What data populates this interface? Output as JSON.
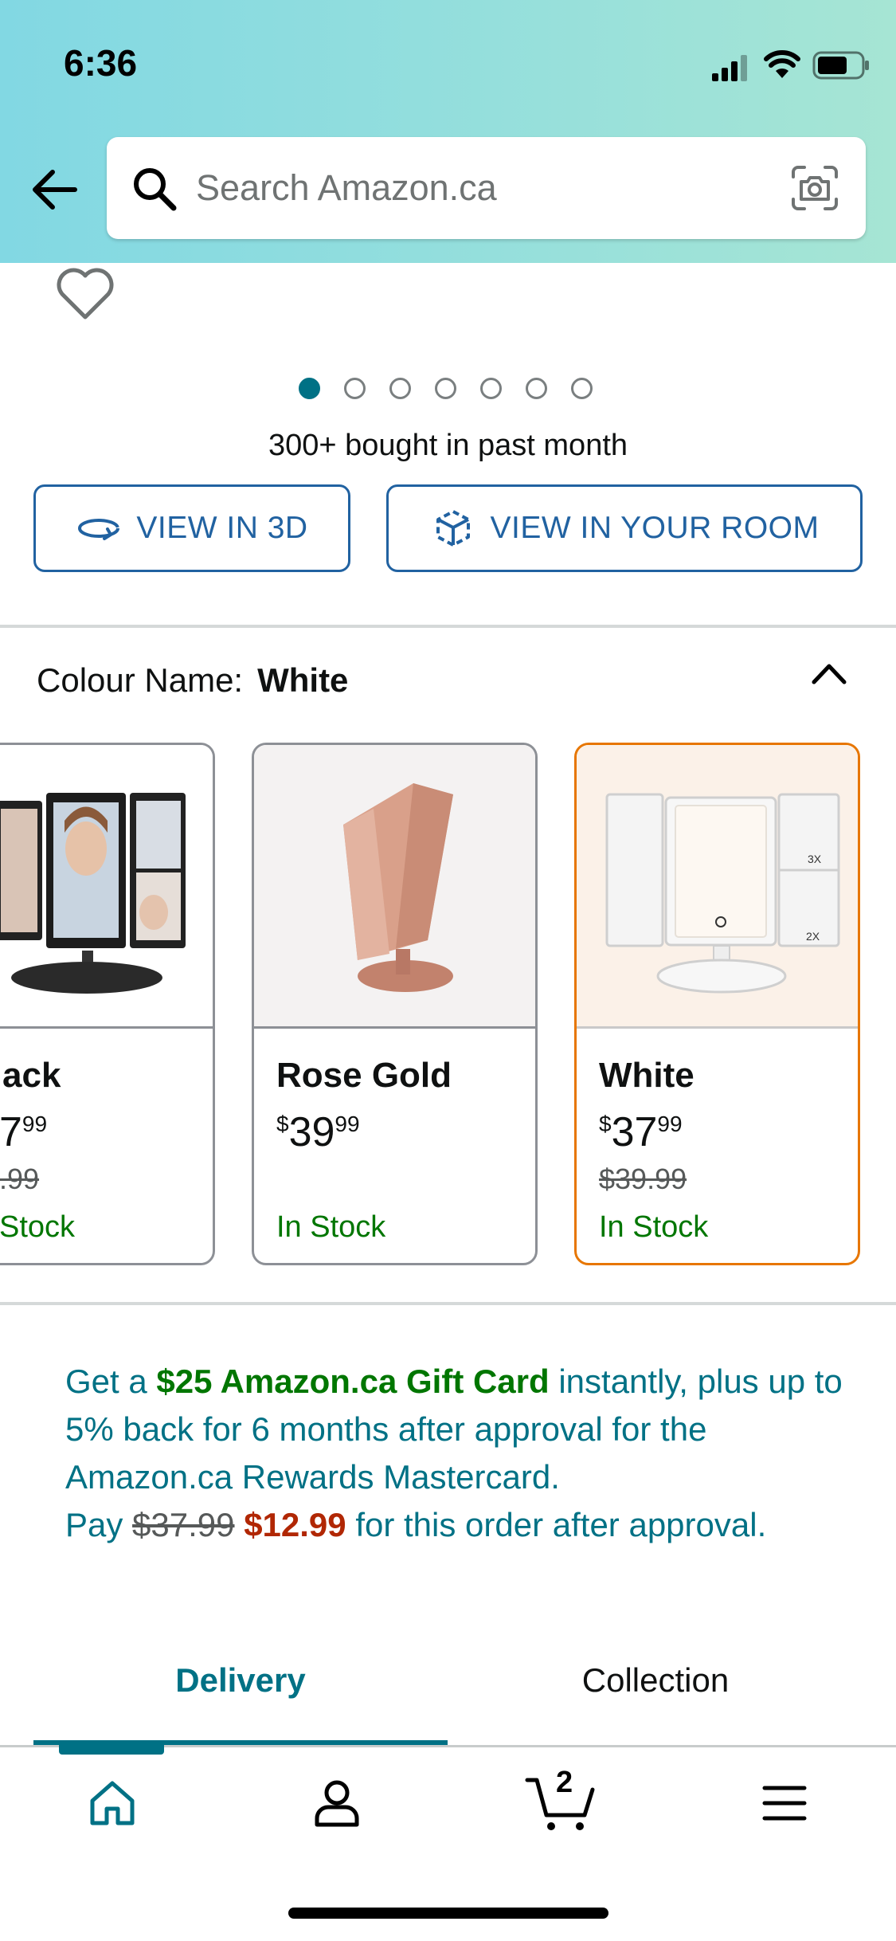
{
  "status_bar": {
    "time": "6:36"
  },
  "header": {
    "search_placeholder": "Search Amazon.ca"
  },
  "product": {
    "image_dots_total": 7,
    "image_dots_active": 1,
    "bought_text": "300+ bought in past month",
    "view_3d_label": "VIEW IN 3D",
    "view_room_label": "VIEW IN YOUR ROOM"
  },
  "colour": {
    "label": "Colour Name:",
    "selected": "White",
    "swatches": [
      {
        "name": "Black",
        "visible_name": "ack",
        "price_visible": "7",
        "cents": "99",
        "was_visible": ".99",
        "stock_visible": "Stock"
      },
      {
        "name": "Rose Gold",
        "currency": "$",
        "price_whole": "39",
        "cents": "99",
        "was": "",
        "stock": "In Stock"
      },
      {
        "name": "White",
        "currency": "$",
        "price_whole": "37",
        "cents": "99",
        "was": "$39.99",
        "stock": "In Stock"
      }
    ]
  },
  "promo": {
    "p1": "Get a ",
    "gift": "$25 Amazon.ca Gift Card",
    "p2": " instantly, plus up to 5% back for 6 months after approval for the Amazon.ca Rewards Mastercard.",
    "pay": "Pay ",
    "old_price": "$37.99",
    "new_price": "$12.99",
    "p3": " for this order after approval."
  },
  "tabs": {
    "delivery": "Delivery",
    "collection": "Collection",
    "active": "Delivery"
  },
  "bottom_nav": {
    "items": [
      "home-icon",
      "account-icon",
      "cart-icon",
      "menu-icon"
    ],
    "cart_count": "2",
    "active": "home"
  },
  "colors": {
    "accent_teal": "#007185",
    "link_blue": "#2162a1",
    "selected_border": "#e77600",
    "in_stock_green": "#007600",
    "deal_red": "#b12704"
  }
}
